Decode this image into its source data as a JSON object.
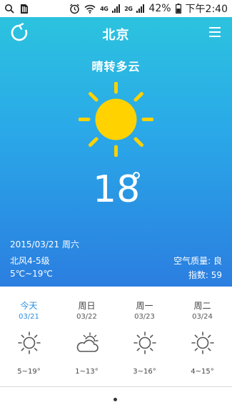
{
  "status_bar": {
    "network_4g": "4G",
    "network_2g": "2G",
    "battery_percent": "42%",
    "time": "下午2:40",
    "icons": [
      "search-icon",
      "sim-card-icon",
      "alarm-icon",
      "wifi-icon",
      "signal-icon",
      "battery-icon"
    ]
  },
  "header": {
    "city": "北京",
    "refresh_icon": "refresh-icon",
    "menu_icon": "menu-icon"
  },
  "current": {
    "condition": "晴转多云",
    "temperature": "18",
    "date": "2015/03/21 周六",
    "wind": "北风4-5级",
    "range": "5℃~19℃",
    "air_quality": "空气质量: 良",
    "index": "指数: 59",
    "icon": "sun-icon"
  },
  "forecast": [
    {
      "name": "今天",
      "date": "03/21",
      "range": "5~19°",
      "icon": "sun-icon",
      "highlight": true
    },
    {
      "name": "周日",
      "date": "03/22",
      "range": "1~13°",
      "icon": "partly-cloudy-icon",
      "highlight": false
    },
    {
      "name": "周一",
      "date": "03/23",
      "range": "3~16°",
      "icon": "sun-icon",
      "highlight": false
    },
    {
      "name": "周二",
      "date": "03/24",
      "range": "4~15°",
      "icon": "sun-icon",
      "highlight": false
    }
  ],
  "colors": {
    "gradient_top": "#2cc7dd",
    "gradient_bottom": "#2b7ee0",
    "sun_yellow": "#ffd200",
    "today_blue": "#2a8de0"
  },
  "pager": {
    "pages": 1,
    "current": 1
  }
}
